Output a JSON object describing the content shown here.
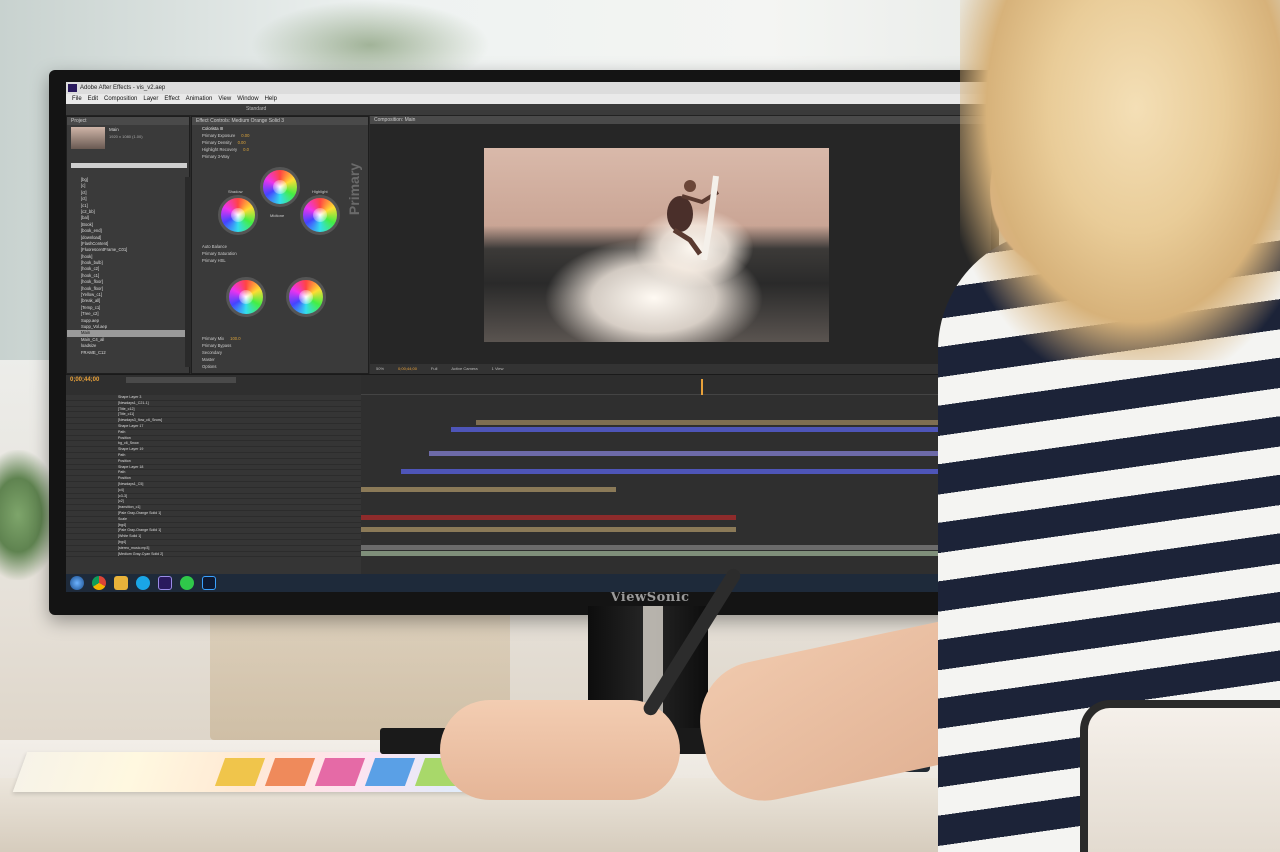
{
  "app": {
    "title": "Adobe After Effects - vis_v2.aep",
    "menu": [
      "File",
      "Edit",
      "Composition",
      "Layer",
      "Effect",
      "Animation",
      "View",
      "Window",
      "Help"
    ],
    "workspace": "Standard"
  },
  "project_panel": {
    "tab": "Project",
    "item_name": "Main",
    "item_info": "1920 x 1080 (1.00)",
    "items": [
      "[bg]",
      "[c]",
      "[ct]",
      "[ct]",
      "[c1]",
      "[c2_bb]",
      "[bal]",
      "[Book]",
      "[book_end]",
      "[download]",
      "[FlashContent]",
      "[FluorescentFrame_C01]",
      "[hook]",
      "[hook_bulb]",
      "[hook_c2]",
      "[hook_c1]",
      "[hook_floor]",
      "[hook_floor]",
      "[Yellow_c1]",
      "[break_all]",
      "[Temp_c1]",
      "[Tree_c2]",
      "Supp.aep",
      "Supp_Vol.aep",
      "Main",
      "Main_C4_all",
      "loadsize",
      "FRAME_C12"
    ],
    "selected": "Main"
  },
  "effect_panel": {
    "tab": "Effect Controls: Medium Orange Solid 3",
    "effect": "Colorista III",
    "rows": [
      {
        "label": "Primary Exposure",
        "value": "0.00"
      },
      {
        "label": "Primary Density",
        "value": "0.00"
      },
      {
        "label": "Highlight Recovery",
        "value": "0.0"
      },
      {
        "label": "Primary 3-Way",
        "value": ""
      }
    ],
    "wheel_labels": [
      "Shadow",
      "Midtone",
      "Highlight"
    ],
    "section_word": "Primary",
    "extra_rows": [
      "Auto Balance",
      "Primary Saturation",
      "Primary HSL",
      "Primary Mix",
      "Primary Bypass",
      "Secondary",
      "Master",
      "Options"
    ],
    "mix_value": "100.0"
  },
  "composition_panel": {
    "tab": "Composition: Main",
    "zoom": "50%",
    "timecode": "0;00;44;00",
    "resolution": "Full",
    "camera": "Active Camera",
    "view": "1 View"
  },
  "timeline": {
    "tab": "Main",
    "timecode": "0;00;44;00",
    "layers": [
      "Shape Layer 3",
      "[Newdays1_C21-1]",
      "[Title_c12]",
      "[Title_c11]",
      "[Newdays3_flow_c6_Snow]",
      "Shape Layer 17",
      "Path",
      "Position",
      "bg_c6_Snow",
      "Shape Layer 19",
      "Path",
      "Position",
      "Shape Layer 18",
      "Path",
      "Position",
      "[Newdays1_C5]",
      "[c4]",
      "[c3-3]",
      "[c2]",
      "[transition_c1]",
      "[Pale Gray-Orange Solid 1]",
      "Scale",
      "[bg4]",
      "[Pale Gray-Orange Solid 1]",
      "[White Solid 1]",
      "[bg4]",
      "[stereo_music.mp3]",
      "[Medium Gray-Cyan Solid 2]"
    ]
  },
  "taskbar_icons": [
    "windows-start",
    "chrome",
    "explorer",
    "skype",
    "after-effects",
    "line",
    "photoshop"
  ],
  "brand": "ViewSonic",
  "colors": {
    "ae_panel": "#3a3a3a",
    "ae_accent": "#e8a13a",
    "timeline_blue": "#4e55b8",
    "timeline_tan": "#8b7a58",
    "timeline_red": "#8e2b2b"
  }
}
